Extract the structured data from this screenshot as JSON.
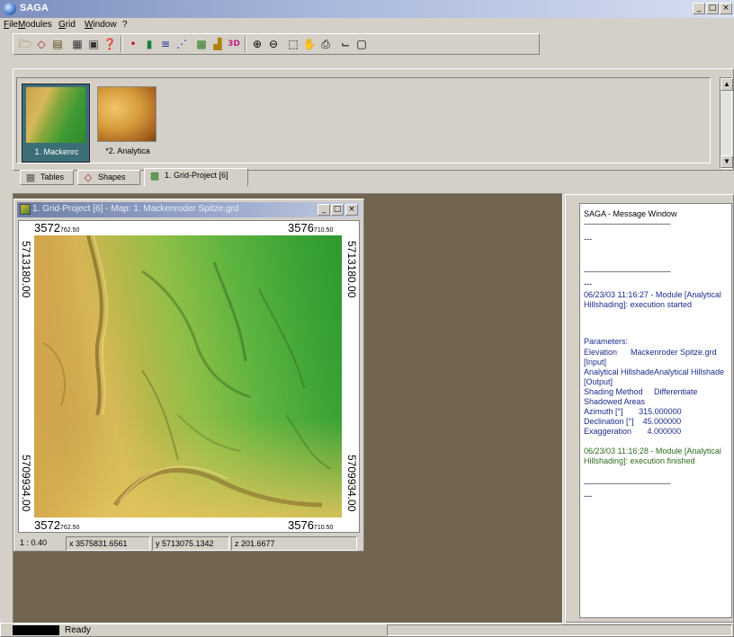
{
  "app": {
    "title": "SAGA",
    "caption_buttons": [
      "_",
      "□",
      "×"
    ]
  },
  "menu": [
    "File",
    "Modules",
    "Grid",
    "Window",
    "?"
  ],
  "toolbar": {
    "icons": [
      "open-icon",
      "shapes-icon",
      "table-icon",
      "grid-icon",
      "layer-icon",
      "wand-icon",
      "points-icon",
      "bars-icon",
      "histogram-icon",
      "scatter-icon",
      "map-icon",
      "bar-chart-icon",
      "3d-icon",
      "zoom-in-icon",
      "zoom-out-icon",
      "select-icon",
      "pan-icon",
      "print-icon",
      "profile-icon",
      "zoom-box-icon"
    ],
    "glyphs": [
      "🗁",
      "◇",
      "▤",
      "▦",
      "▣",
      "❓",
      "•",
      "▮",
      "≡",
      "⋰",
      "▩",
      "▟",
      "3D",
      "⊕",
      "⊖",
      "⬚",
      "✋",
      "⎙",
      "⌙",
      "▢"
    ]
  },
  "workspace": {
    "thumbnails": [
      {
        "label": "1. Mackenrc",
        "selected": true
      },
      {
        "label": "*2. Analytica",
        "selected": false
      }
    ],
    "tabs": [
      "Tables",
      "Shapes",
      "1. Grid-Project [6]"
    ]
  },
  "map_window": {
    "title": "1. Grid-Project [6] - Map: 1. Mackenroder Spitze.grd",
    "caption_buttons": [
      "_",
      "□",
      "×"
    ],
    "top_left_x": {
      "main": "3572",
      "small": "762.50"
    },
    "top_right_x": {
      "main": "3576",
      "small": "710.50"
    },
    "bottom_left_x": {
      "main": "3572",
      "small": "762.50"
    },
    "bottom_right_x": {
      "main": "3576",
      "small": "710.50"
    },
    "left_top_y": "5713180.00",
    "left_bottom_y": "5709934.00",
    "right_top_y": "5713180.00",
    "right_bottom_y": "5709934.00",
    "status": {
      "scale": "1 : 0.40",
      "x": "x 3575831.6561",
      "y": "y 5713075.1342",
      "z": "z 201.6677"
    }
  },
  "message_window": {
    "title": "SAGA - Message Window",
    "separator": "------------------------------------------------",
    "dash": "---",
    "start_msg": "06/23/03 11:16:27 - Module [Analytical Hillshading]: execution started",
    "parameters_label": "Parameters:",
    "params": [
      "Elevation      Mackenroder Spitze.grd [Input]",
      "Analytical HillshadeAnalytical Hillshade  [Output]",
      "Shading Method     Differentiate Shadowed Areas",
      "Azimuth [°]       315.000000",
      "Declination [°]    45.000000",
      "Exaggeration       4.000000"
    ],
    "end_msg": "06/23/03 11:16:28 - Module [Analytical Hillshading]: execution finished"
  },
  "statusbar": {
    "text": "Ready",
    "progress": 0.0
  },
  "colors": {
    "mdi_background": "#72654f",
    "title_gradient_start": "#7d8fbe",
    "message_navy": "#1a2b8a",
    "message_green": "#2d6a1a"
  }
}
